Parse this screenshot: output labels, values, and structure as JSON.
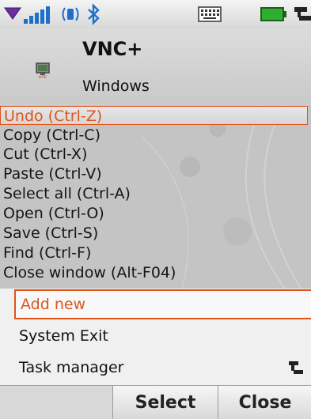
{
  "header": {
    "title": "VNC+",
    "subtitle": "Windows"
  },
  "menu": {
    "items": [
      {
        "label": "Undo (Ctrl-Z)"
      },
      {
        "label": "Copy (Ctrl-C)"
      },
      {
        "label": "Cut (Ctrl-X)"
      },
      {
        "label": "Paste (Ctrl-V)"
      },
      {
        "label": "Select all (Ctrl-A)"
      },
      {
        "label": "Open (Ctrl-O)"
      },
      {
        "label": "Save (Ctrl-S)"
      },
      {
        "label": "Find (Ctrl-F)"
      },
      {
        "label": "Close window (Alt-F04)"
      }
    ]
  },
  "list": {
    "items": [
      {
        "label": "Add new"
      },
      {
        "label": "System Exit"
      },
      {
        "label": "Task manager"
      }
    ]
  },
  "softkeys": {
    "left": "Select",
    "right": "Close"
  },
  "colors": {
    "accent": "#e0541a"
  }
}
